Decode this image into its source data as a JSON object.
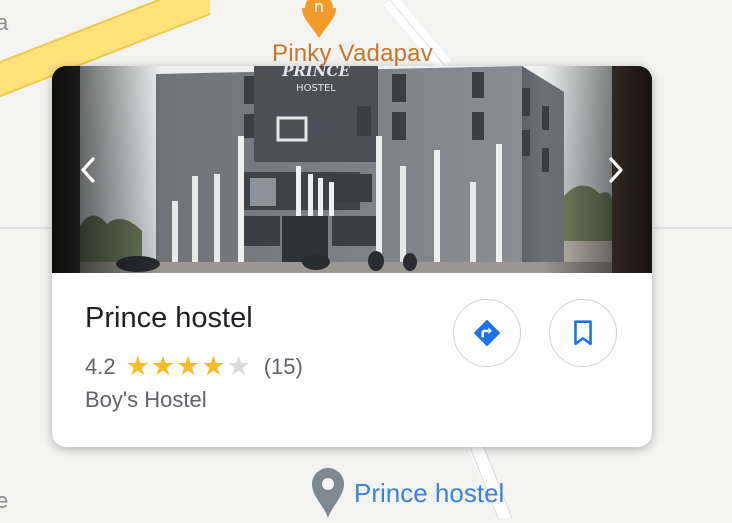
{
  "map": {
    "top_place_label": "Pinky Vadapav",
    "bottom_place_label": "Prince hostel",
    "left_edge_glyph": "a",
    "left_bottom_glyph": "e"
  },
  "place_card": {
    "name": "Prince hostel",
    "rating": "4.2",
    "stars_filled": 4,
    "stars_total": 5,
    "review_count": "(15)",
    "category": "Boy's Hostel",
    "photo_sign_line1": "PRINCE",
    "photo_sign_line2": "HOSTEL"
  },
  "icons": {
    "prev": "chevron-left-icon",
    "next": "chevron-right-icon",
    "directions": "directions-icon",
    "save": "bookmark-icon",
    "pin": "map-pin-icon"
  },
  "colors": {
    "accent_blue": "#1a73e8",
    "star_yellow": "#f5bd23",
    "top_label_orange": "#c5772c",
    "bottom_label_blue": "#3b83d9"
  }
}
